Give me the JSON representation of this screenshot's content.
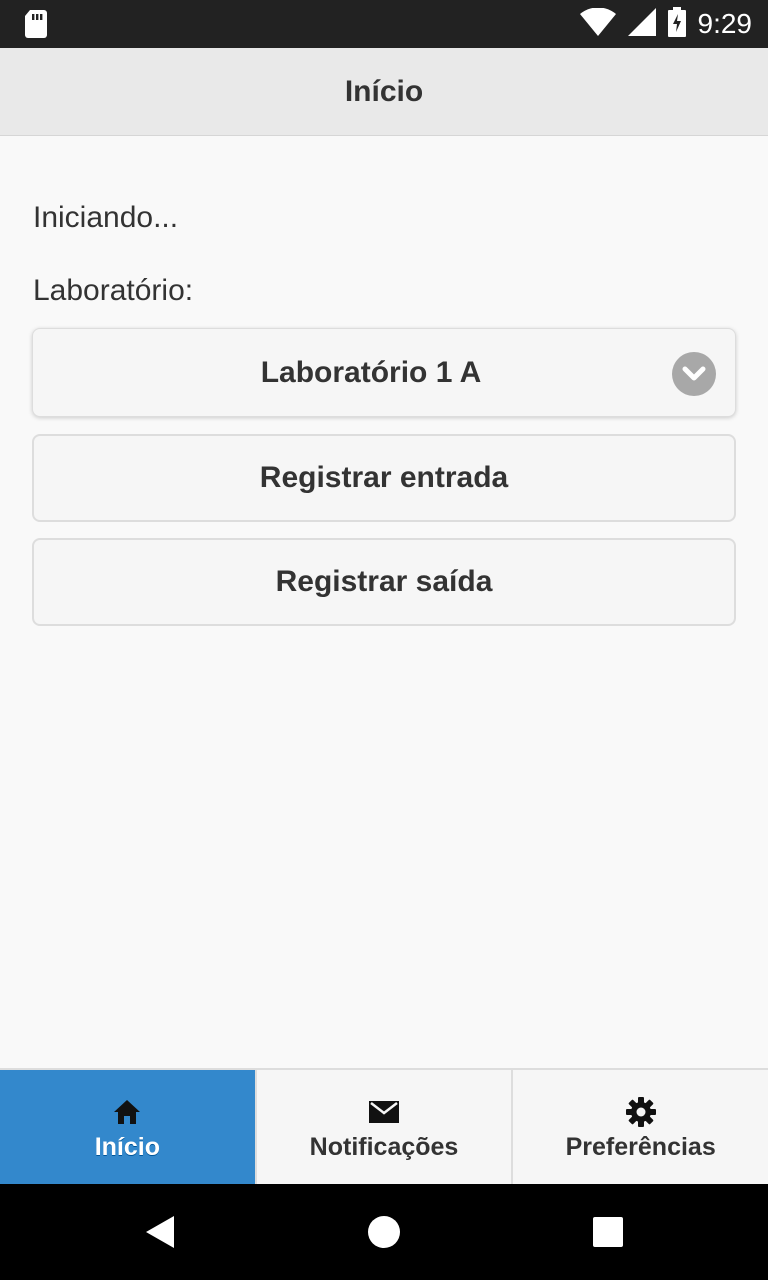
{
  "status_bar": {
    "time": "9:29",
    "icons": [
      "sd-card-icon",
      "wifi-icon",
      "signal-icon",
      "battery-charging-icon"
    ]
  },
  "header": {
    "title": "Início"
  },
  "main": {
    "status_text": "Iniciando...",
    "lab_label": "Laboratório:",
    "lab_select": {
      "selected": "Laboratório 1 A",
      "icon": "chevron-down-icon"
    },
    "buttons": {
      "entrada": "Registrar entrada",
      "saida": "Registrar saída"
    }
  },
  "tabs": [
    {
      "label": "Início",
      "icon": "home-icon",
      "active": true
    },
    {
      "label": "Notificações",
      "icon": "mail-icon",
      "active": false
    },
    {
      "label": "Preferências",
      "icon": "gear-icon",
      "active": false
    }
  ],
  "nav_bar": {
    "buttons": [
      "back-icon",
      "home-circle-icon",
      "recents-icon"
    ]
  },
  "colors": {
    "accent": "#3388cc",
    "header_bg": "#e9e9e9",
    "status_bar_bg": "#222222"
  }
}
